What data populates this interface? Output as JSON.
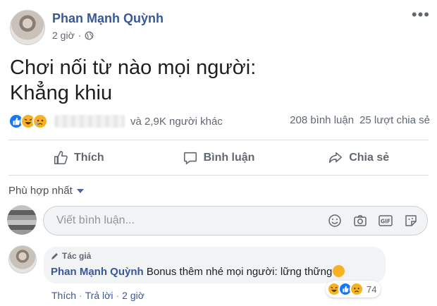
{
  "post": {
    "author": "Phan Mạnh Quỳnh",
    "time": "2 giờ",
    "separator": "·",
    "more_icon": "more-horizontal-icon",
    "text_lines": [
      "Chơi nối từ nào mọi người:",
      "Khẳng khiu"
    ]
  },
  "reactions": {
    "types": [
      "like",
      "haha",
      "sad"
    ],
    "others_text": "và 2,9K người khác",
    "comments_count": "208 bình luận",
    "shares_count": "25 lượt chia sẻ"
  },
  "actions": {
    "like": "Thích",
    "comment": "Bình luận",
    "share": "Chia sẻ"
  },
  "sort": {
    "label": "Phù hợp nhất"
  },
  "composer": {
    "placeholder": "Viết bình luận...",
    "value": "",
    "icons": [
      "emoji-icon",
      "camera-icon",
      "gif-icon",
      "sticker-icon"
    ]
  },
  "comment": {
    "badge": "Tác giả",
    "author": "Phan Mạnh Quỳnh",
    "text": "Bonus thêm nhé mọi người: lững thững",
    "reaction_count": "74",
    "like_label": "Thích",
    "reply_label": "Trả lời",
    "time": "2 giờ",
    "dot": "·"
  },
  "colors": {
    "link_blue": "#385898",
    "like_blue": "#1877f2",
    "reaction_yellow": "#f7b125",
    "muted": "#606770"
  }
}
